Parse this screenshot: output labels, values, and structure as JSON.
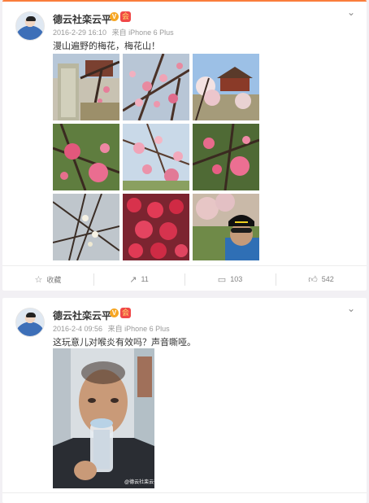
{
  "posts": [
    {
      "author": "德云社栾云平",
      "verified_badge": "V",
      "member_badge": "会",
      "time": "2016-2-29 16:10",
      "source": "来自 iPhone 6 Plus",
      "text": "漫山遍野的梅花，梅花山！",
      "menu_icon": "chevron-down-icon",
      "actions": {
        "favorite": "收藏",
        "repost": "11",
        "comment": "103",
        "like": "542"
      }
    },
    {
      "author": "德云社栾云平",
      "verified_badge": "V",
      "member_badge": "会",
      "time": "2016-2-4 09:56",
      "source": "来自 iPhone 6 Plus",
      "text": "这玩意儿对喉炎有效吗？声音嘶哑。",
      "menu_icon": "chevron-down-icon",
      "watermark": "@德云社栾云平",
      "actions": {}
    }
  ],
  "colors": {
    "accent": "#fa7d3c",
    "meta_text": "#999999",
    "action_text": "#808080"
  }
}
